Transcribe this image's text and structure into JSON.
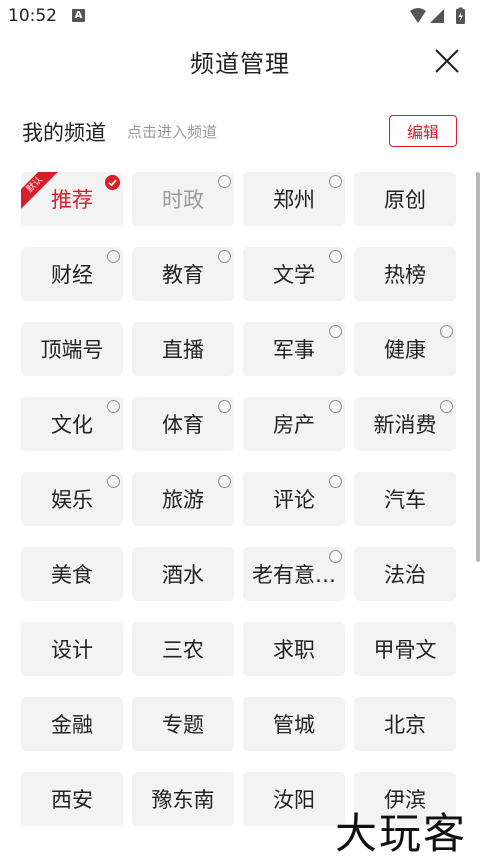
{
  "status_bar": {
    "time": "10:52",
    "notification_icon": "A"
  },
  "header": {
    "title": "频道管理",
    "close_icon": "close-icon"
  },
  "section": {
    "title": "我的频道",
    "hint": "点击进入频道",
    "edit_label": "编辑"
  },
  "default_badge": "默认",
  "channels": [
    {
      "label": "推荐",
      "state": "active",
      "mark": "check"
    },
    {
      "label": "时政",
      "state": "disabled",
      "mark": "circle"
    },
    {
      "label": "郑州",
      "state": "normal",
      "mark": "circle"
    },
    {
      "label": "原创",
      "state": "normal",
      "mark": "none"
    },
    {
      "label": "财经",
      "state": "normal",
      "mark": "circle"
    },
    {
      "label": "教育",
      "state": "normal",
      "mark": "circle"
    },
    {
      "label": "文学",
      "state": "normal",
      "mark": "circle"
    },
    {
      "label": "热榜",
      "state": "normal",
      "mark": "none"
    },
    {
      "label": "顶端号",
      "state": "normal",
      "mark": "none"
    },
    {
      "label": "直播",
      "state": "normal",
      "mark": "none"
    },
    {
      "label": "军事",
      "state": "normal",
      "mark": "circle"
    },
    {
      "label": "健康",
      "state": "normal",
      "mark": "circle"
    },
    {
      "label": "文化",
      "state": "normal",
      "mark": "circle"
    },
    {
      "label": "体育",
      "state": "normal",
      "mark": "circle"
    },
    {
      "label": "房产",
      "state": "normal",
      "mark": "circle"
    },
    {
      "label": "新消费",
      "state": "normal",
      "mark": "circle"
    },
    {
      "label": "娱乐",
      "state": "normal",
      "mark": "circle"
    },
    {
      "label": "旅游",
      "state": "normal",
      "mark": "circle"
    },
    {
      "label": "评论",
      "state": "normal",
      "mark": "circle"
    },
    {
      "label": "汽车",
      "state": "normal",
      "mark": "none"
    },
    {
      "label": "美食",
      "state": "normal",
      "mark": "none"
    },
    {
      "label": "酒水",
      "state": "normal",
      "mark": "none"
    },
    {
      "label": "老有意…",
      "state": "normal",
      "mark": "circle"
    },
    {
      "label": "法治",
      "state": "normal",
      "mark": "none"
    },
    {
      "label": "设计",
      "state": "normal",
      "mark": "none"
    },
    {
      "label": "三农",
      "state": "normal",
      "mark": "none"
    },
    {
      "label": "求职",
      "state": "normal",
      "mark": "none"
    },
    {
      "label": "甲骨文",
      "state": "normal",
      "mark": "none"
    },
    {
      "label": "金融",
      "state": "normal",
      "mark": "none"
    },
    {
      "label": "专题",
      "state": "normal",
      "mark": "none"
    },
    {
      "label": "管城",
      "state": "normal",
      "mark": "none"
    },
    {
      "label": "北京",
      "state": "normal",
      "mark": "none"
    },
    {
      "label": "西安",
      "state": "normal",
      "mark": "none"
    },
    {
      "label": "豫东南",
      "state": "normal",
      "mark": "none"
    },
    {
      "label": "汝阳",
      "state": "normal",
      "mark": "none"
    },
    {
      "label": "伊滨",
      "state": "normal",
      "mark": "none"
    }
  ],
  "watermark": "大玩客"
}
